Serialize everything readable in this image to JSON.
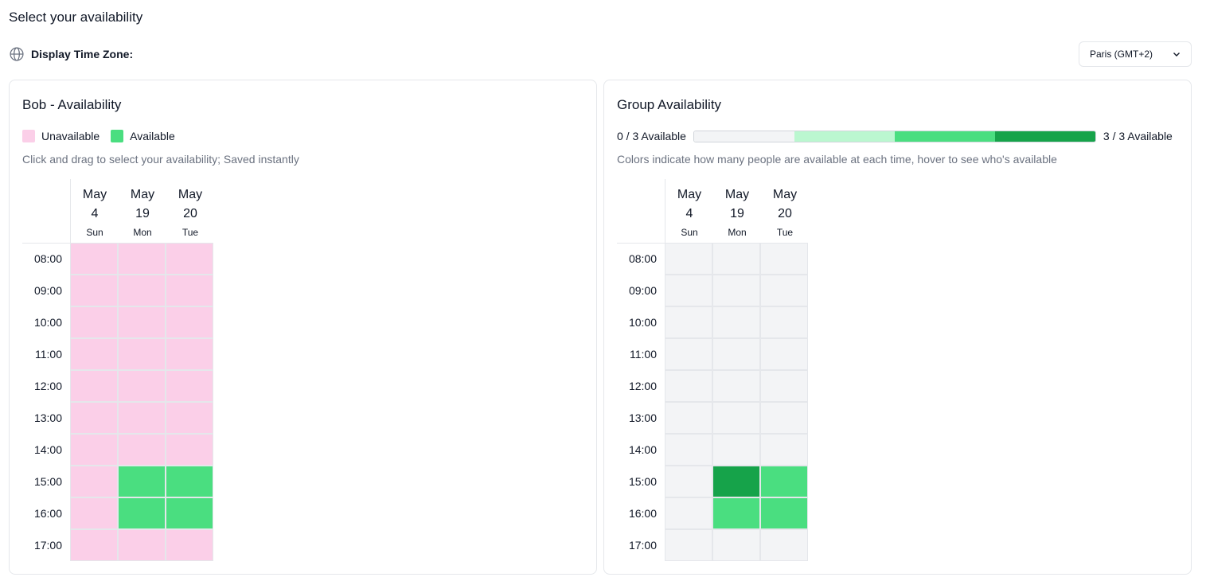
{
  "page": {
    "title": "Select your availability"
  },
  "timezone": {
    "label": "Display Time Zone:",
    "selected": "Paris (GMT+2)"
  },
  "colors": {
    "unavailable": "#fbcfe8",
    "available": "#4ade80",
    "empty": "#f3f4f6",
    "level_1": "#bbf7d0",
    "level_2": "#4ade80",
    "level_3": "#16a34a"
  },
  "left_panel": {
    "title": "Bob - Availability",
    "legend": {
      "unavailable": "Unavailable",
      "available": "Available"
    },
    "hint": "Click and drag to select your availability; Saved instantly",
    "days": [
      {
        "month": "May",
        "day": "4",
        "weekday": "Sun"
      },
      {
        "month": "May",
        "day": "19",
        "weekday": "Mon"
      },
      {
        "month": "May",
        "day": "20",
        "weekday": "Tue"
      }
    ],
    "times": [
      "08:00",
      "09:00",
      "10:00",
      "11:00",
      "12:00",
      "13:00",
      "14:00",
      "15:00",
      "16:00",
      "17:00"
    ],
    "availability": [
      [
        0,
        0,
        0
      ],
      [
        0,
        0,
        0
      ],
      [
        0,
        0,
        0
      ],
      [
        0,
        0,
        0
      ],
      [
        0,
        0,
        0
      ],
      [
        0,
        0,
        0
      ],
      [
        0,
        0,
        0
      ],
      [
        0,
        1,
        1
      ],
      [
        0,
        1,
        1
      ],
      [
        0,
        0,
        0
      ]
    ]
  },
  "right_panel": {
    "title": "Group Availability",
    "scale_min_label": "0 / 3 Available",
    "scale_max_label": "3 / 3 Available",
    "hint": "Colors indicate how many people are available at each time, hover to see who's available",
    "days": [
      {
        "month": "May",
        "day": "4",
        "weekday": "Sun"
      },
      {
        "month": "May",
        "day": "19",
        "weekday": "Mon"
      },
      {
        "month": "May",
        "day": "20",
        "weekday": "Tue"
      }
    ],
    "times": [
      "08:00",
      "09:00",
      "10:00",
      "11:00",
      "12:00",
      "13:00",
      "14:00",
      "15:00",
      "16:00",
      "17:00"
    ],
    "counts": [
      [
        0,
        0,
        0
      ],
      [
        0,
        0,
        0
      ],
      [
        0,
        0,
        0
      ],
      [
        0,
        0,
        0
      ],
      [
        0,
        0,
        0
      ],
      [
        0,
        0,
        0
      ],
      [
        0,
        0,
        0
      ],
      [
        0,
        3,
        2
      ],
      [
        0,
        2,
        2
      ],
      [
        0,
        0,
        0
      ]
    ]
  }
}
